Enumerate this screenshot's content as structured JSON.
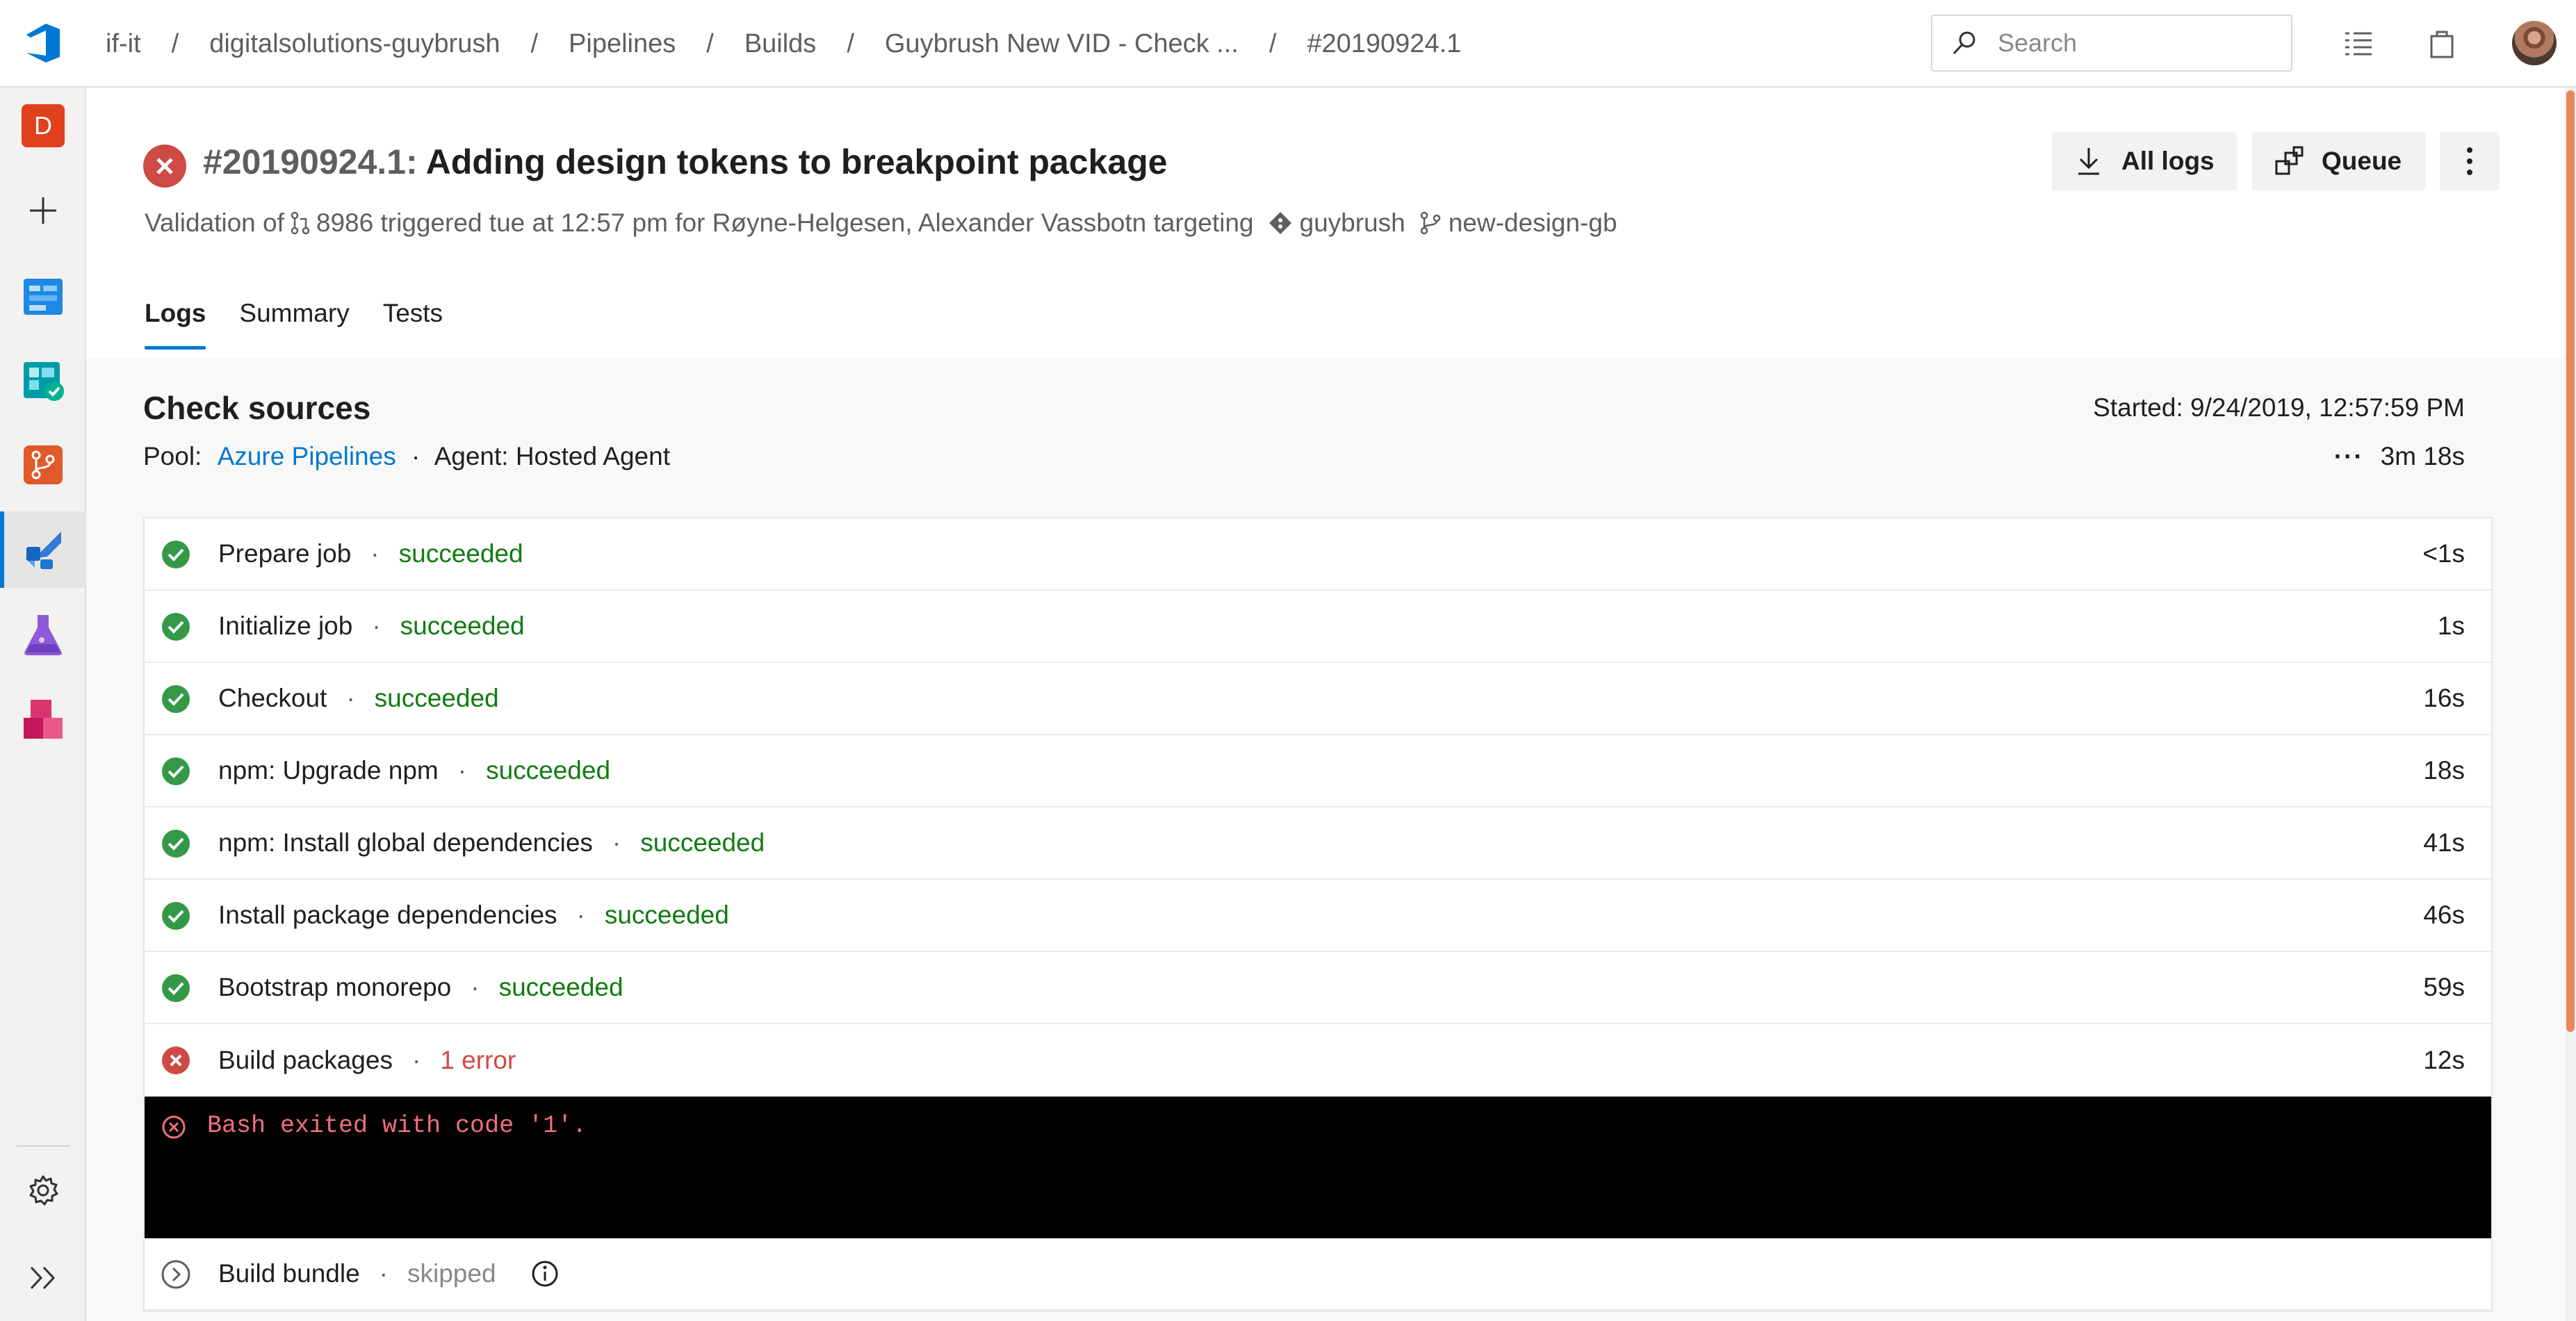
{
  "breadcrumbs": [
    "if-it",
    "digitalsolutions-guybrush",
    "Pipelines",
    "Builds",
    "Guybrush New VID - Check ...",
    "#20190924.1"
  ],
  "search": {
    "placeholder": "Search"
  },
  "rail": {
    "org_initial": "D",
    "items": [
      "add-icon",
      "boards-icon",
      "boards-check-icon",
      "repos-icon",
      "pipelines-icon",
      "test-plans-icon",
      "artifacts-icon"
    ],
    "bottom": [
      "gear-icon",
      "expand-icon"
    ]
  },
  "header": {
    "build_number": "#20190924.1:",
    "title": " Adding design tokens to breakpoint package",
    "subtitle_prefix": "Validation of",
    "subtitle_middle": "8986 triggered tue at 12:57 pm for Røyne-Helgesen, Alexander Vassbotn targeting",
    "repo": "guybrush",
    "branch": "new-design-gb",
    "all_logs_label": "All logs",
    "queue_label": "Queue"
  },
  "tabs": [
    "Logs",
    "Summary",
    "Tests"
  ],
  "job": {
    "title": "Check sources",
    "pool_label": "Pool:",
    "pool_name": "Azure Pipelines",
    "agent": "Agent: Hosted Agent",
    "started": "Started: 9/24/2019, 12:57:59 PM",
    "more": "···",
    "duration": "3m 18s"
  },
  "steps": [
    {
      "name": "Prepare job",
      "state": "succeeded",
      "duration": "<1s"
    },
    {
      "name": "Initialize job",
      "state": "succeeded",
      "duration": "1s"
    },
    {
      "name": "Checkout",
      "state": "succeeded",
      "duration": "16s"
    },
    {
      "name": "npm: Upgrade npm",
      "state": "succeeded",
      "duration": "18s"
    },
    {
      "name": "npm: Install global dependencies",
      "state": "succeeded",
      "duration": "41s"
    },
    {
      "name": "Install package dependencies",
      "state": "succeeded",
      "duration": "46s"
    },
    {
      "name": "Bootstrap monorepo",
      "state": "succeeded",
      "duration": "59s"
    },
    {
      "name": "Build packages",
      "state": "1 error",
      "duration": "12s"
    }
  ],
  "console": {
    "message": "Bash exited with code '1'."
  },
  "skipped_step": {
    "name": "Build bundle",
    "state": "skipped"
  },
  "colors": {
    "success": "#107c10",
    "error": "#cd4a45",
    "accent": "#0078d4",
    "link": "#0078d4"
  }
}
